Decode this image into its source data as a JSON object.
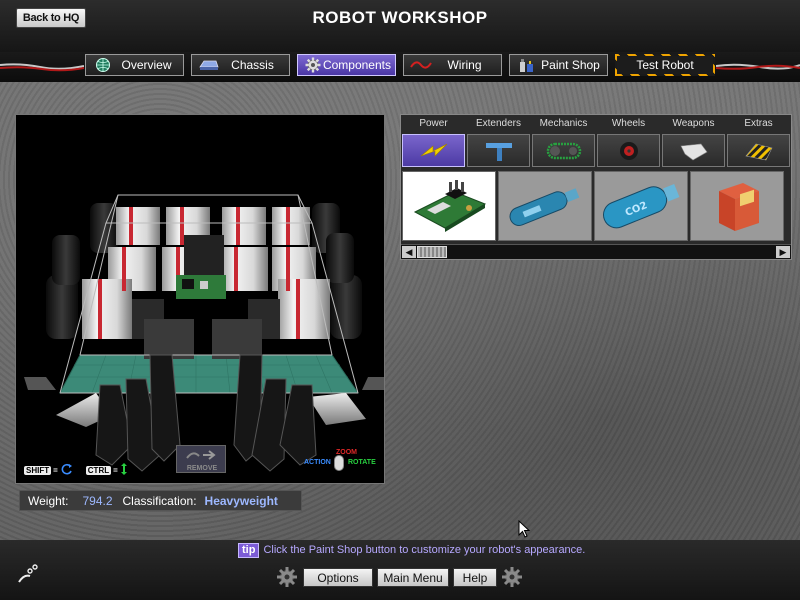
{
  "header": {
    "back_label": "Back to HQ",
    "title": "ROBOT WORKSHOP"
  },
  "tabs": [
    {
      "label": "Overview",
      "icon": "globe-icon"
    },
    {
      "label": "Chassis",
      "icon": "chassis-icon"
    },
    {
      "label": "Components",
      "icon": "gear-icon",
      "active": true
    },
    {
      "label": "Wiring",
      "icon": "wire-icon"
    },
    {
      "label": "Paint Shop",
      "icon": "paint-icon"
    },
    {
      "label": "Test Robot",
      "icon": "hazard-stripe"
    }
  ],
  "viewport": {
    "shift_key": "SHIFT",
    "ctrl_key": "CTRL",
    "remove_label": "REMOVE",
    "zoom_label": "ZOOM",
    "action_label": "ACTION",
    "rotate_label": "ROTATE"
  },
  "stats": {
    "weight_label": "Weight:",
    "weight_value": "794.2",
    "class_label": "Classification:",
    "class_value": "Heavyweight"
  },
  "categories": [
    {
      "label": "Power",
      "icon": "lightning-icon",
      "active": true
    },
    {
      "label": "Extenders",
      "icon": "extender-icon"
    },
    {
      "label": "Mechanics",
      "icon": "chain-icon"
    },
    {
      "label": "Wheels",
      "icon": "wheel-icon"
    },
    {
      "label": "Weapons",
      "icon": "blade-icon"
    },
    {
      "label": "Extras",
      "icon": "plow-icon"
    }
  ],
  "items": [
    {
      "name": "circuit-board",
      "selected": true
    },
    {
      "name": "blue-tank"
    },
    {
      "name": "co2-tank",
      "text": "CO2"
    },
    {
      "name": "battery-box"
    }
  ],
  "tip": {
    "badge": "tip",
    "text": "Click the Paint Shop button to customize your robot's appearance."
  },
  "footer": {
    "options": "Options",
    "main_menu": "Main Menu",
    "help": "Help"
  },
  "colors": {
    "accent": "#5a44b8",
    "hazard": "#f0a400",
    "stat_value": "#9db8ff"
  }
}
